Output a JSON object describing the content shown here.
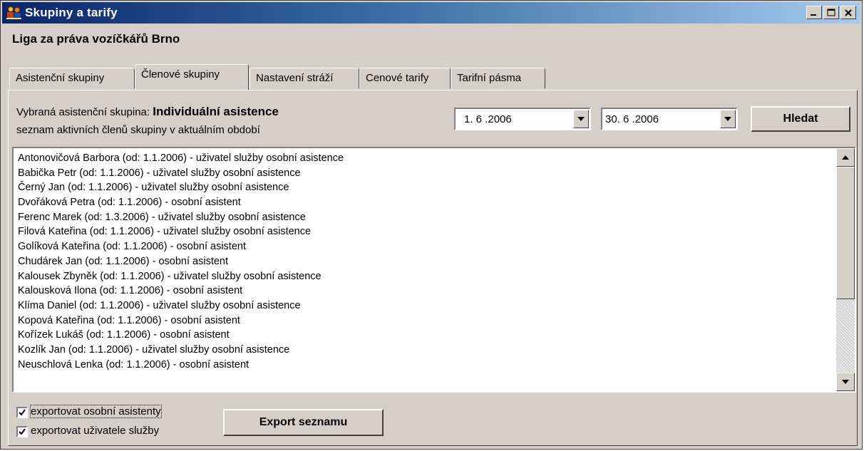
{
  "window": {
    "title": "Skupiny a tarify",
    "accent": "#0a246a"
  },
  "org_name": "Liga za práva vozíčkářů Brno",
  "tabs": [
    {
      "label": "Asistenční skupiny",
      "active": false
    },
    {
      "label": "Členové skupiny",
      "active": true
    },
    {
      "label": "Nastavení stráží",
      "active": false
    },
    {
      "label": "Cenové tarify",
      "active": false
    },
    {
      "label": "Tarifní pásma",
      "active": false
    }
  ],
  "group": {
    "label": "Vybraná asistenční skupina:",
    "value": "Individuální asistence",
    "subtitle": "seznam aktivních členů skupiny v aktuálním období"
  },
  "date_from": "1. 6 .2006",
  "date_to": "30. 6 .2006",
  "search_button": "Hledat",
  "members": [
    "Antonovičová Barbora (od: 1.1.2006) - uživatel služby osobní asistence",
    "Babička Petr (od: 1.1.2006) - uživatel služby osobní asistence",
    "Černý Jan (od: 1.1.2006) - uživatel služby osobní asistence",
    "Dvořáková Petra (od: 1.1.2006) - osobní asistent",
    "Ferenc Marek (od: 1.3.2006) - uživatel služby osobní asistence",
    "Filová Kateřina (od: 1.1.2006) - uživatel služby osobní asistence",
    "Golíková Kateřina (od: 1.1.2006) - osobní asistent",
    "Chudárek Jan (od: 1.1.2006) - osobní asistent",
    "Kalousek Zbyněk (od: 1.1.2006) - uživatel služby osobní asistence",
    "Kalousková Ilona (od: 1.1.2006) - osobní asistent",
    "Klíma Daniel (od: 1.1.2006) - uživatel služby osobní asistence",
    "Kopová Kateřina (od: 1.1.2006) - osobní asistent",
    "Kořízek Lukáš (od: 1.1.2006) - osobní asistent",
    "Kozlík Jan (od: 1.1.2006) - uživatel služby osobní asistence",
    "Neuschlová Lenka (od: 1.1.2006) - osobní asistent"
  ],
  "export": {
    "chk_assistants": {
      "label": "exportovat osobní asistenty",
      "checked": true
    },
    "chk_users": {
      "label": "exportovat uživatele služby",
      "checked": true
    },
    "button": "Export seznamu"
  }
}
